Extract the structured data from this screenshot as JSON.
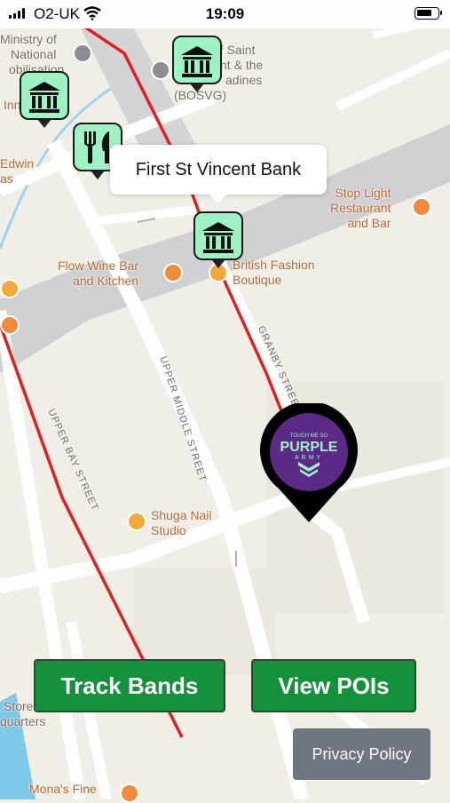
{
  "status_bar": {
    "carrier": "O2-UK",
    "time": "19:09"
  },
  "map": {
    "callout": "First St Vincent Bank",
    "places": {
      "ministry": [
        "Ministry of",
        "National",
        "obilisation"
      ],
      "bosvg": [
        "of Saint",
        "nt & the",
        "adines",
        "(BOSVG)"
      ],
      "inn": "Inn",
      "edwin": [
        "Edwin",
        "as"
      ],
      "stop_light": [
        "Stop Light",
        "Restaurant",
        "and Bar"
      ],
      "flow_wine": [
        "Flow Wine Bar",
        "and Kitchen"
      ],
      "british_fashion": [
        "British Fashion",
        "Boutique"
      ],
      "shuga_nail": [
        "Shuga Nail",
        "Studio"
      ],
      "store": [
        "Store",
        "quarters"
      ],
      "monas": "Mona's Fine"
    },
    "streets": {
      "granby": "GRANBY STREET",
      "upper_middle": "UPPER MIDDLE STREET",
      "upper_bay": "UPPER BAY STREET"
    },
    "marker_icons": [
      "bank-marker",
      "bank-marker",
      "restaurant-marker",
      "bank-marker",
      "purple-army-marker"
    ],
    "purple_marker_logo": {
      "top": "TOUCH ME SO",
      "main": "PURPLE",
      "bottom": "ARMY"
    }
  },
  "buttons": {
    "track_bands": "Track Bands",
    "view_pois": "View POIs",
    "privacy_policy": "Privacy Policy"
  },
  "colors": {
    "button_green": "#14913a",
    "marker_mint": "#9ef2c4",
    "route_red": "#e02020",
    "purple": "#5b2a86"
  }
}
